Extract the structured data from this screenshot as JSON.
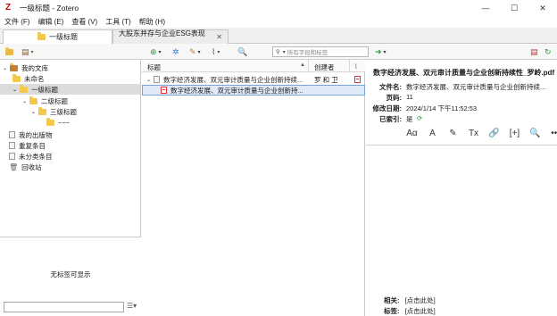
{
  "window": {
    "title": "一级标题 - Zotero",
    "controls": [
      "—",
      "☐",
      "✕"
    ]
  },
  "menu": [
    "文件 (F)",
    "编辑 (E)",
    "查看 (V)",
    "工具 (T)",
    "帮助 (H)"
  ],
  "tabs": [
    {
      "label": "一级标题"
    },
    {
      "label": "大股东并存与企业ESG表现 ...",
      "close": "✕"
    }
  ],
  "toolbar": {
    "search_placeholder": "所有字段和标签"
  },
  "collections": [
    {
      "label": "我的文库",
      "level": 0,
      "expanded": true
    },
    {
      "label": "未命名",
      "level": 1
    },
    {
      "label": "一级标题",
      "level": 1,
      "expanded": true,
      "selected": true
    },
    {
      "label": "二级标题",
      "level": 2,
      "expanded": true
    },
    {
      "label": "三级标题",
      "level": 3,
      "expanded": true
    },
    {
      "label": "~~~",
      "level": 4
    },
    {
      "label": "我的出版物",
      "level": 0
    },
    {
      "label": "重复条目",
      "level": 0
    },
    {
      "label": "未分类条目",
      "level": 0
    },
    {
      "label": "回收站",
      "level": 0
    }
  ],
  "tag_pane": {
    "empty_text": "无标签可显示"
  },
  "items": {
    "columns": {
      "title": "标题",
      "creator": "创建者"
    },
    "rows": [
      {
        "title": "数字经济发展、双元审计质量与企业创新持续...",
        "creator": "罗 和 卫"
      },
      {
        "title": "数字经济发展、双元审计质量与企业创新持...",
        "creator": ""
      }
    ]
  },
  "item_pane": {
    "title": "数字经济发展、双元审计质量与企业创新持续性_罗岭.pdf",
    "fields": [
      {
        "label": "文件名:",
        "value": "数字经济发展、双元审计质量与企业创新持续..."
      },
      {
        "label": "页码:",
        "value": "11"
      },
      {
        "label": "修改日期:",
        "value": "2024/1/14 下午11:52:53"
      },
      {
        "label": "已索引:",
        "value": "是"
      }
    ],
    "formatting_icons": [
      "Aα",
      "A",
      "✎",
      "Tx",
      "🔗",
      "[+]",
      "🔍",
      "•••"
    ],
    "related": {
      "label": "相关:",
      "value": "[点击此处]"
    },
    "tags": {
      "label": "标签:",
      "value": "[点击此处]"
    }
  }
}
